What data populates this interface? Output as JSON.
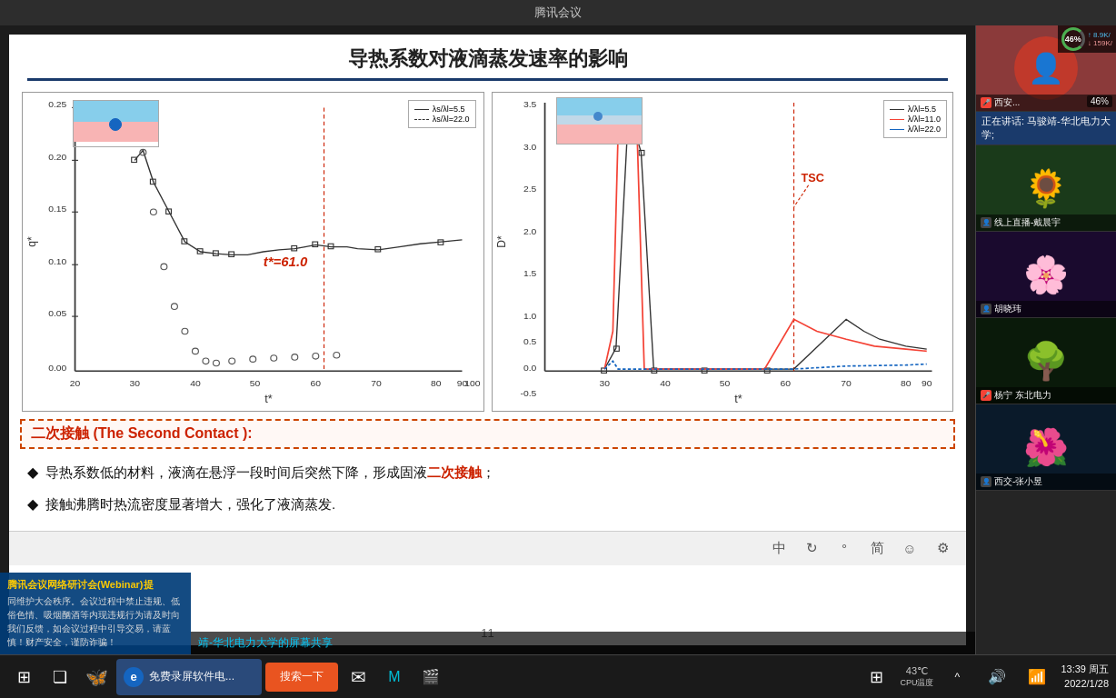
{
  "app": {
    "title": "腾讯会议",
    "window_controls": [
      "minimize",
      "maximize",
      "close"
    ]
  },
  "slide": {
    "title": "导热系数对液滴蒸发速率的影响",
    "chart_left": {
      "y_label": "q*",
      "x_label": "t*",
      "legend": [
        {
          "symbol": "□",
          "label": "λs/λl=5.5"
        },
        {
          "symbol": "○",
          "label": "λs/λl=22.0"
        }
      ],
      "t_star_label": "t*=61.0",
      "thumbnail_desc": "droplet on surface"
    },
    "chart_right": {
      "y_label": "D*",
      "x_label": "t*",
      "legend": [
        {
          "symbol": "□",
          "color": "#000",
          "label": "λ/λl=5.5"
        },
        {
          "symbol": "□",
          "color": "#f44336",
          "label": "λ/λl=11.0"
        },
        {
          "symbol": "□",
          "color": "#1565c0",
          "label": "λ/λl=22.0"
        }
      ],
      "tsc_label": "TSC",
      "thumbnail_desc": "droplet on layered surface"
    },
    "bullets": [
      {
        "diamond": "◆",
        "text_normal": "导热系数低的材料，液滴在悬浮一段时间后突然下降，形成固液",
        "text_red": "二次接触",
        "text_after": "；"
      },
      {
        "diamond": "◆",
        "text": "接触沸腾时热流密度显著增大，强化了液滴蒸发."
      }
    ],
    "second_contact_section": {
      "title": "二次接触 (The Second Contact ):",
      "title_color": "#cc2200"
    },
    "page_number": "11"
  },
  "toolbar": {
    "buttons": [
      "中",
      "↻",
      "°",
      "简",
      "☺",
      "⚙"
    ]
  },
  "network": {
    "percentage": "46%",
    "up_speed": "8.9K/",
    "down_speed": "159K/"
  },
  "speaking": {
    "label": "正在讲话: 马骏靖-华北电力大学;"
  },
  "sidebar": {
    "participants": [
      {
        "name": "西安...",
        "mic": true,
        "percentage": "46%",
        "bg": "#c0392b",
        "avatar": "person"
      },
      {
        "name": "线上直播-戴晨宇",
        "mic": false,
        "bg": "#2ecc71",
        "avatar": "sunflower"
      },
      {
        "name": "胡晓玮",
        "mic": false,
        "bg": "#8e44ad",
        "avatar": "flower"
      },
      {
        "name": "杨宁 东北电力",
        "mic": true,
        "bg": "#e67e22",
        "avatar": "tree"
      },
      {
        "name": "西交-张小昱",
        "mic": false,
        "bg": "#1abc9c",
        "avatar": "person2"
      }
    ]
  },
  "notification": {
    "title": "腾讯会议网络研讨会(Webinar)提",
    "text": "同维护大会秩序。会议过程中禁止违规、低俗色情、吸烟酗酒等内现违规行为请及时向我们反馈，如会议过程中引导交易，请蓝慎！财产安全，谨防诈骗！"
  },
  "sharing_label": "靖-华北电力大学的屏幕共享",
  "taskbar": {
    "start_icon": "⊞",
    "task_view": "❏",
    "search_app_icon": "e",
    "search_app_label": "免费录屏软件电...",
    "search_btn": "搜索一下",
    "email_icon": "✉",
    "meet_icon": "M",
    "cam_icon": "▶",
    "apps_icon": "⊞",
    "temp": "43℃\nCPU温度",
    "time": "13:39 周五\n2022/1/28",
    "tray_icons": [
      "^",
      "🔊",
      "📶"
    ]
  }
}
